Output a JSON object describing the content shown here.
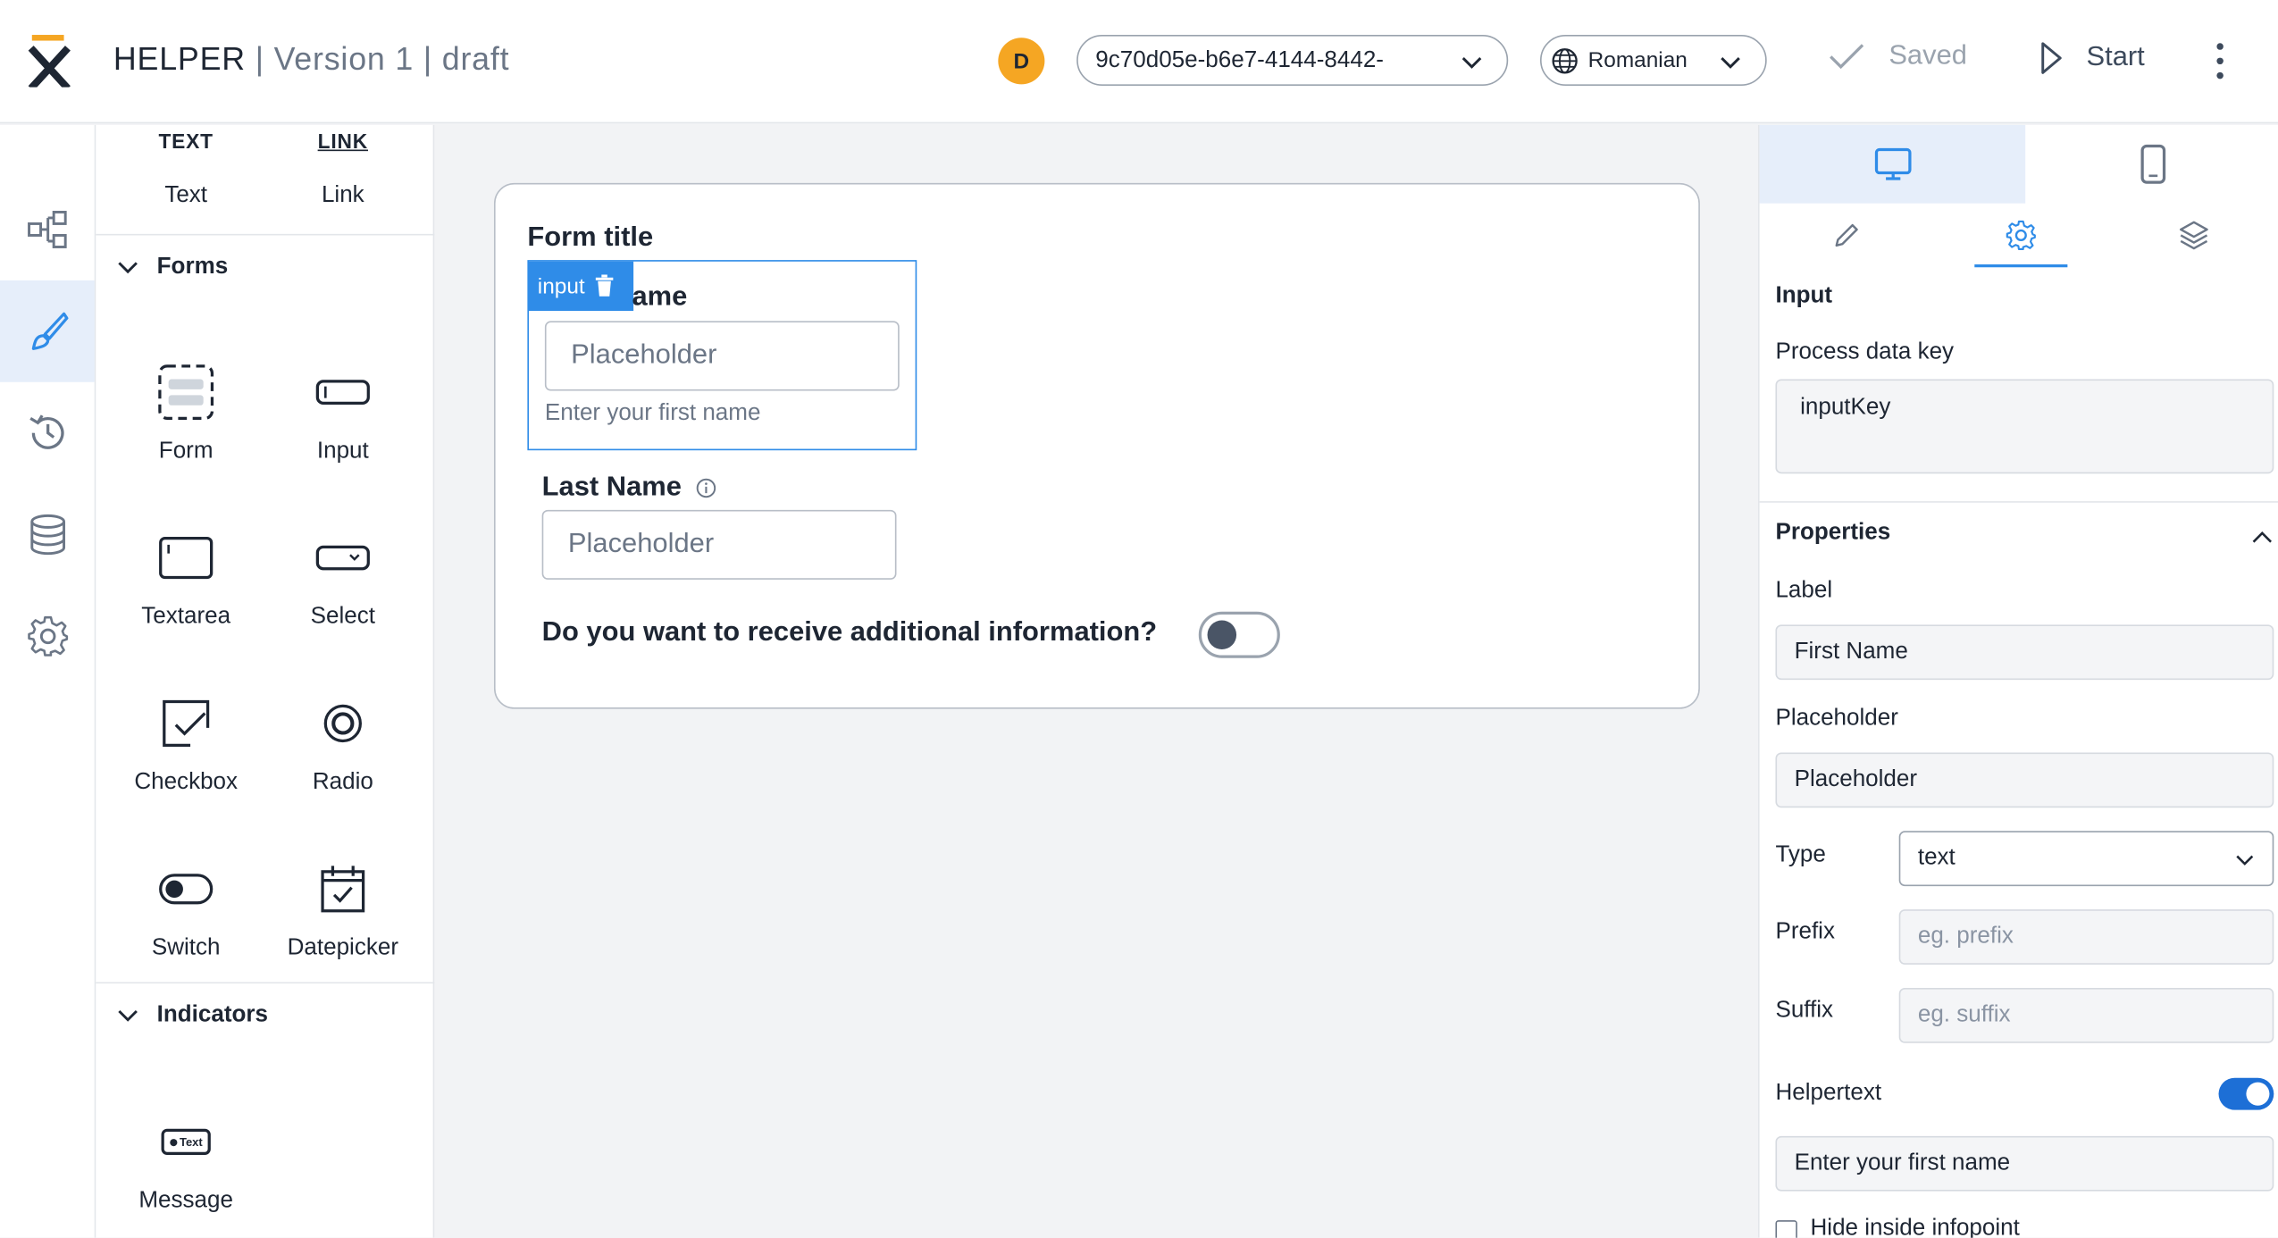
{
  "header": {
    "app_name": "HELPER",
    "version": "Version 1",
    "status": "draft",
    "avatar_initial": "D",
    "process_id": "9c70d05e-b6e7-4144-8442-",
    "language": "Romanian",
    "saved_label": "Saved",
    "start_label": "Start"
  },
  "components": {
    "top_items": [
      {
        "mini": "TEXT",
        "label": "Text"
      },
      {
        "mini": "LINK",
        "label": "Link"
      }
    ],
    "forms_title": "Forms",
    "forms": [
      "Form",
      "Input",
      "Textarea",
      "Select",
      "Checkbox",
      "Radio",
      "Switch",
      "Datepicker"
    ],
    "indicators_title": "Indicators",
    "message_badge": "Text",
    "indicators": [
      "Message"
    ]
  },
  "canvas": {
    "form_title": "Form title",
    "selected_tag": "input",
    "first_name_label_visible": "ame",
    "first_name_placeholder": "Placeholder",
    "first_name_helper": "Enter your first name",
    "last_name_label": "Last Name",
    "last_name_placeholder": "Placeholder",
    "switch_label": "Do you want to receive additional information?"
  },
  "right_panel": {
    "section_title": "Input",
    "process_key_label": "Process data key",
    "process_key_value": "inputKey",
    "properties_title": "Properties",
    "label_label": "Label",
    "label_value": "First Name",
    "placeholder_label": "Placeholder",
    "placeholder_value": "Placeholder",
    "type_label": "Type",
    "type_value": "text",
    "prefix_label": "Prefix",
    "prefix_placeholder": "eg. prefix",
    "suffix_label": "Suffix",
    "suffix_placeholder": "eg. suffix",
    "helpertext_label": "Helpertext",
    "helpertext_value": "Enter your first name",
    "hide_infopoint_label": "Hide inside infopoint"
  },
  "colors": {
    "accent": "#2f8ce8",
    "toggle_on": "#1d6fd6",
    "avatar": "#f5a623"
  }
}
